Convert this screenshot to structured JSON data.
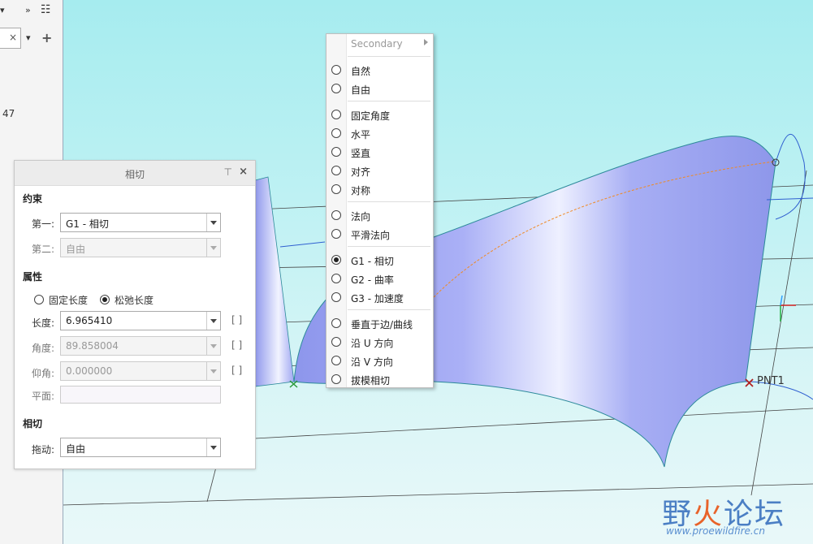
{
  "left_panel": {
    "toolbar_chevron": "»",
    "filter_clear": "×",
    "add": "+",
    "partial_number": "47"
  },
  "dialog": {
    "title": "相切",
    "pin": "⊤",
    "close": "×",
    "constraints_header": "约束",
    "first_label": "第一:",
    "first_value": "G1 - 相切",
    "second_label": "第二:",
    "second_value": "自由",
    "properties_header": "属性",
    "fixed_length": "固定长度",
    "relax_length": "松弛长度",
    "length_label": "长度:",
    "length_value": "6.965410",
    "angle_label": "角度:",
    "angle_value": "89.858004",
    "elevation_label": "仰角:",
    "elevation_value": "0.000000",
    "plane_label": "平面:",
    "tangent_header": "相切",
    "drag_label": "拖动:",
    "drag_value": "自由",
    "bracket": "[ ]"
  },
  "menu": {
    "secondary": "Secondary",
    "items": [
      {
        "label": "自然",
        "selected": false
      },
      {
        "label": "自由",
        "selected": false
      },
      {
        "label": "固定角度",
        "selected": false
      },
      {
        "label": "水平",
        "selected": false
      },
      {
        "label": "竖直",
        "selected": false
      },
      {
        "label": "对齐",
        "selected": false
      },
      {
        "label": "对称",
        "selected": false
      },
      {
        "label": "法向",
        "selected": false
      },
      {
        "label": "平滑法向",
        "selected": false
      },
      {
        "label": "G1 - 相切",
        "selected": true
      },
      {
        "label": "G2 - 曲率",
        "selected": false
      },
      {
        "label": "G3 - 加速度",
        "selected": false
      },
      {
        "label": "垂直于边/曲线",
        "selected": false
      },
      {
        "label": "沿 U 方向",
        "selected": false
      },
      {
        "label": "沿 V 方向",
        "selected": false
      },
      {
        "label": "拔模相切",
        "selected": false
      }
    ]
  },
  "viewport": {
    "point_label": "PNT1",
    "watermark_main": "野火论坛",
    "watermark_main_a": "野",
    "watermark_main_b": "火",
    "watermark_main_c": "论坛",
    "watermark_url": "www.proewildfire.cn"
  },
  "colors": {
    "surface": "#9ea6f0",
    "curve": "#f08a24",
    "selected_radio": "#222222"
  }
}
